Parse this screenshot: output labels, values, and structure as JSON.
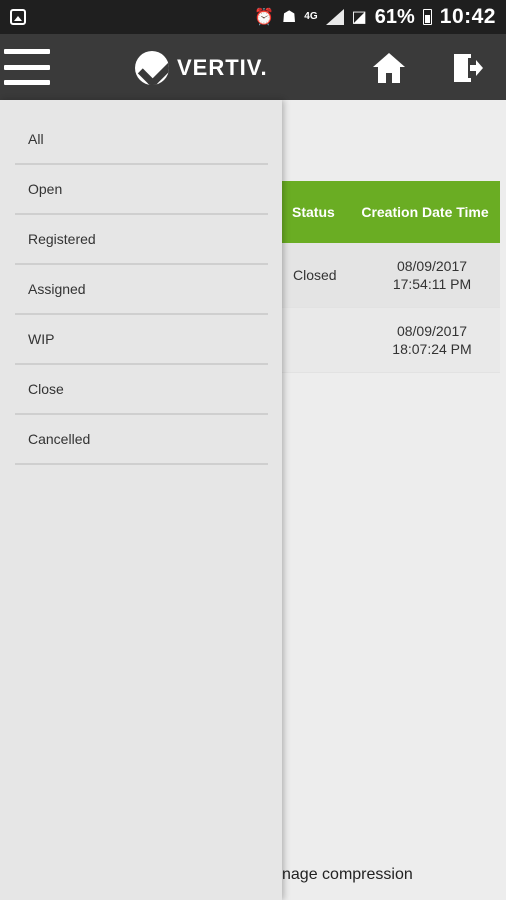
{
  "status_bar": {
    "battery_percent": "61%",
    "time": "10:42",
    "network": "4G",
    "icons": [
      "image-icon",
      "alarm-icon",
      "notification-icon",
      "signal-icon",
      "no-sim-icon",
      "battery-icon"
    ]
  },
  "header": {
    "logo_text": "VERTIV.",
    "menu_icon": "hamburger-menu-icon",
    "home_icon": "home-icon",
    "exit_icon": "logout-icon"
  },
  "drawer": {
    "items": [
      {
        "label": "All"
      },
      {
        "label": "Open"
      },
      {
        "label": "Registered"
      },
      {
        "label": "Assigned"
      },
      {
        "label": "WIP"
      },
      {
        "label": "Close"
      },
      {
        "label": "Cancelled"
      }
    ]
  },
  "table": {
    "columns": [
      "Status",
      "Creation Date Time"
    ],
    "rows": [
      {
        "status": "Closed",
        "date": "08/09/2017",
        "time": "17:54:11 PM"
      },
      {
        "status": "",
        "date": "08/09/2017",
        "time": "18:07:24 PM"
      }
    ]
  },
  "footer_text": "nage compression",
  "colors": {
    "header_bg": "#3a3a3a",
    "accent_green": "#6aad23",
    "statusbar_bg": "#1f1f1f"
  }
}
